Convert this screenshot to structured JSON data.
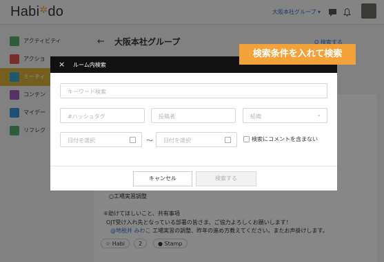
{
  "app": {
    "logo_prefix": "Habi",
    "logo_star": "✲",
    "logo_suffix": "do"
  },
  "topbar": {
    "group_switch": "大阪本社グループ ▾"
  },
  "sidebar": {
    "items": [
      {
        "label": "アクティビティ",
        "color": "#5aa86a"
      },
      {
        "label": "アクショ",
        "color": "#d9534f"
      },
      {
        "label": "ミーティ",
        "color": "#3aa0c7"
      },
      {
        "label": "コンテン",
        "color": "#9b59b6"
      },
      {
        "label": "マイデー",
        "color": "#3a8fd0"
      },
      {
        "label": "リフレク",
        "color": "#5aa86a"
      }
    ]
  },
  "main": {
    "back": "←",
    "group_title": "大阪本社グループ",
    "search_link": "Q 検索する",
    "post": {
      "line1": "○工場実習調整",
      "line2": "⑥助けてほしいこと、共有事項",
      "line3": "OJT受け入れ先となっている部署の皆さま、ご協力よろしくお願いします！",
      "mention": "@地税井 みわこ",
      "line4_rest": " 工場実習の調整、昨年の進め方教えてください。またお声掛けします。",
      "chip_habi": "☆ Habi",
      "chip_count": "2",
      "chip_stamp": "● Stamp"
    }
  },
  "modal": {
    "close": "×",
    "title": "ルーム内検索",
    "keyword_placeholder": "キーワード検索",
    "hashtag_placeholder": "#ハッシュタグ",
    "poster_placeholder": "投稿者",
    "org_placeholder": "組織",
    "date_from_placeholder": "日付を選択",
    "tilde": "〜",
    "date_to_placeholder": "日付を選択",
    "exclude_comments_label": "検索にコメントを含まない",
    "cancel_label": "キャンセル",
    "search_label": "検索する"
  },
  "callout": {
    "text": "検索条件を入れて検索",
    "color": "#f3a23a"
  }
}
